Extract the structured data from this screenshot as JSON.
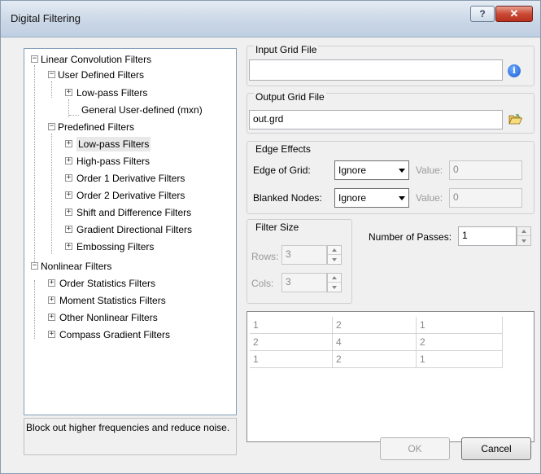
{
  "window": {
    "title": "Digital Filtering",
    "help_glyph": "?",
    "close_glyph": "✕"
  },
  "tree": {
    "items": [
      {
        "label": "Linear Convolution Filters",
        "expander": "−"
      },
      {
        "label": "User Defined Filters",
        "expander": "−"
      },
      {
        "label": "Low-pass Filters",
        "expander": "+"
      },
      {
        "label": "General User-defined (mxn)"
      },
      {
        "label": "Predefined Filters",
        "expander": "−"
      },
      {
        "label": "Low-pass Filters",
        "expander": "+"
      },
      {
        "label": "High-pass Filters",
        "expander": "+"
      },
      {
        "label": "Order 1 Derivative Filters",
        "expander": "+"
      },
      {
        "label": "Order 2 Derivative Filters",
        "expander": "+"
      },
      {
        "label": "Shift and Difference Filters",
        "expander": "+"
      },
      {
        "label": "Gradient Directional Filters",
        "expander": "+"
      },
      {
        "label": "Embossing Filters",
        "expander": "+"
      },
      {
        "label": "Nonlinear Filters",
        "expander": "−"
      },
      {
        "label": "Order Statistics Filters",
        "expander": "+"
      },
      {
        "label": "Moment Statistics Filters",
        "expander": "+"
      },
      {
        "label": "Other Nonlinear Filters",
        "expander": "+"
      },
      {
        "label": "Compass Gradient Filters",
        "expander": "+"
      }
    ]
  },
  "description": "Block out higher frequencies and reduce noise.",
  "input_grid": {
    "label": "Input Grid File",
    "value": "",
    "icon": "info-icon"
  },
  "output_grid": {
    "label": "Output Grid File",
    "value": "out.grd",
    "icon": "folder-open-icon"
  },
  "edge_effects": {
    "label": "Edge Effects",
    "edge_of_grid_label": "Edge of Grid:",
    "edge_of_grid_value": "Ignore",
    "edge_value_label": "Value:",
    "edge_value": "0",
    "blanked_nodes_label": "Blanked Nodes:",
    "blanked_nodes_value": "Ignore",
    "blanked_value_label": "Value:",
    "blanked_value": "0"
  },
  "filter_size": {
    "label": "Filter Size",
    "rows_label": "Rows:",
    "rows_value": "3",
    "cols_label": "Cols:",
    "cols_value": "3"
  },
  "passes": {
    "label": "Number of Passes:",
    "value": "1"
  },
  "matrix": {
    "rows": [
      [
        "1",
        "2",
        "1"
      ],
      [
        "2",
        "4",
        "2"
      ],
      [
        "1",
        "2",
        "1"
      ]
    ]
  },
  "buttons": {
    "ok": "OK",
    "cancel": "Cancel"
  }
}
